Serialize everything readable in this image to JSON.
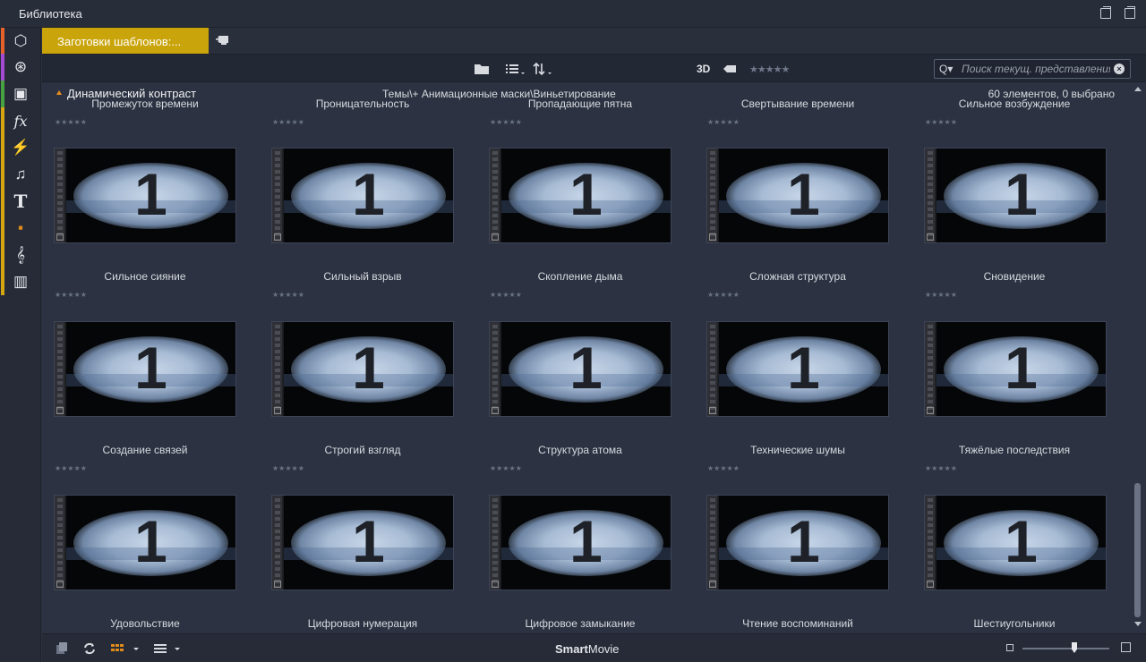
{
  "window": {
    "title": "Библиотека"
  },
  "sidebar": {
    "items": [
      {
        "icon": "box-icon",
        "glyph": "⬡",
        "color": "#e7622b"
      },
      {
        "icon": "film-reel-icon",
        "glyph": "⊛",
        "color": "#a44ad3"
      },
      {
        "icon": "photo-stack-icon",
        "glyph": "▣",
        "color": "#47a341"
      },
      {
        "icon": "fx-icon",
        "glyph": "fx",
        "color": "#d6a611"
      },
      {
        "icon": "transition-icon",
        "glyph": "⚡",
        "color": "#d6a611"
      },
      {
        "icon": "music-note-icon",
        "glyph": "♫",
        "color": "#d6a611"
      },
      {
        "icon": "title-text-icon",
        "glyph": "T",
        "color": "#d6a611"
      },
      {
        "icon": "montage-icon",
        "glyph": "▪",
        "color": "#d6a611"
      },
      {
        "icon": "treble-clef-icon",
        "glyph": "𝄞",
        "color": "#d6a611"
      },
      {
        "icon": "piano-icon",
        "glyph": "▥",
        "color": "#d6a611"
      }
    ]
  },
  "tabs": {
    "active_label": "Заготовки шаблонов:...",
    "add_icon": "add-tab-icon"
  },
  "toolbar": {
    "folder_icon": "folder-icon",
    "list_icon": "list-view-icon",
    "sort_icon": "sort-icon",
    "label_3d": "3D",
    "tag_icon": "tag-icon",
    "rating": "★★★★★",
    "search_placeholder": "Поиск текущ. представления"
  },
  "path": {
    "folder": "Динамический контраст",
    "breadcrumb": "Темы\\+ Анимационные маски\\Виньетирование",
    "count": "60 элементов, 0 выбрано"
  },
  "grid": {
    "top_partial_labels": [
      "Промежуток времени",
      "Проницательность",
      "Пропадающие пятна",
      "Свертывание времени",
      "Сильное возбуждение"
    ],
    "rows": [
      {
        "labels": [
          "Сильное сияние",
          "Сильный взрыв",
          "Скопление дыма",
          "Сложная структура",
          "Сновидение"
        ]
      },
      {
        "labels": [
          "Создание связей",
          "Строгий взгляд",
          "Структура атома",
          "Технические шумы",
          "Тяжёлые последствия"
        ]
      },
      {
        "labels": [
          "Удовольствие",
          "Цифровая нумерация",
          "Цифровое замыкание",
          "Чтение воспоминаний",
          "Шестиугольники"
        ]
      }
    ],
    "thumbnail_number": "1",
    "rating": "★★★★★"
  },
  "bottombar": {
    "brand_bold": "Smart",
    "brand_rest": "Movie",
    "zoom_level": 0.6
  }
}
